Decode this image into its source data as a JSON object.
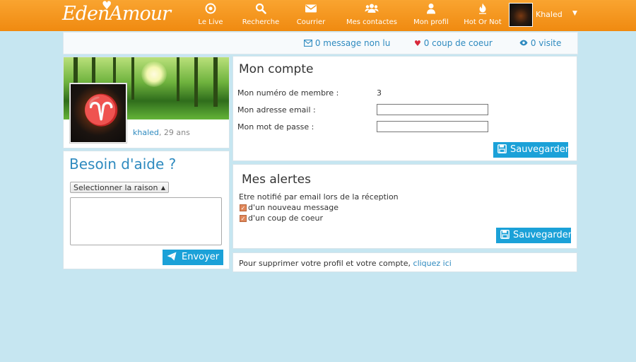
{
  "app": {
    "logo_left": "Eden",
    "logo_right": "Amour",
    "logo_heart": "♥"
  },
  "nav": [
    {
      "label": "Le Live",
      "icon": "live-icon"
    },
    {
      "label": "Recherche",
      "icon": "search-icon"
    },
    {
      "label": "Courrier",
      "icon": "envelope-icon"
    },
    {
      "label": "Mes contactes",
      "icon": "contacts-icon"
    },
    {
      "label": "Mon profil",
      "icon": "profile-icon"
    },
    {
      "label": "Hot Or Not",
      "icon": "flame-icon"
    }
  ],
  "user": {
    "name": "Khaled"
  },
  "stats": {
    "messages": "0 message non lu",
    "coups": "0 coup de coeur",
    "visites": "0 visite"
  },
  "profile": {
    "name": "khaled",
    "age_suffix": ", 29 ans"
  },
  "help": {
    "title": "Besoin d'aide ?",
    "select_value": "Selectionner la raison",
    "send_label": "Envoyer"
  },
  "account": {
    "title": "Mon compte",
    "member_label": "Mon numéro de membre :",
    "member_value": "3",
    "email_label": "Mon adresse email :",
    "email_value": "",
    "password_label": "Mon mot de passe :",
    "password_value": "",
    "save_label": "Sauvegarder"
  },
  "alerts": {
    "title": "Mes alertes",
    "intro": "Etre notifié par email lors de la réception",
    "options": [
      {
        "label": "d'un nouveau message",
        "checked": true
      },
      {
        "label": "d'un coup de coeur",
        "checked": true
      }
    ],
    "save_label": "Sauvegarder"
  },
  "delete": {
    "text": "Pour supprimer votre profil et votre compte, ",
    "link": "cliquez ici"
  },
  "colors": {
    "topbar": "#f39a1f",
    "accent": "#1ba1d8",
    "link": "#2e8abf",
    "background": "#c6e6f1"
  }
}
